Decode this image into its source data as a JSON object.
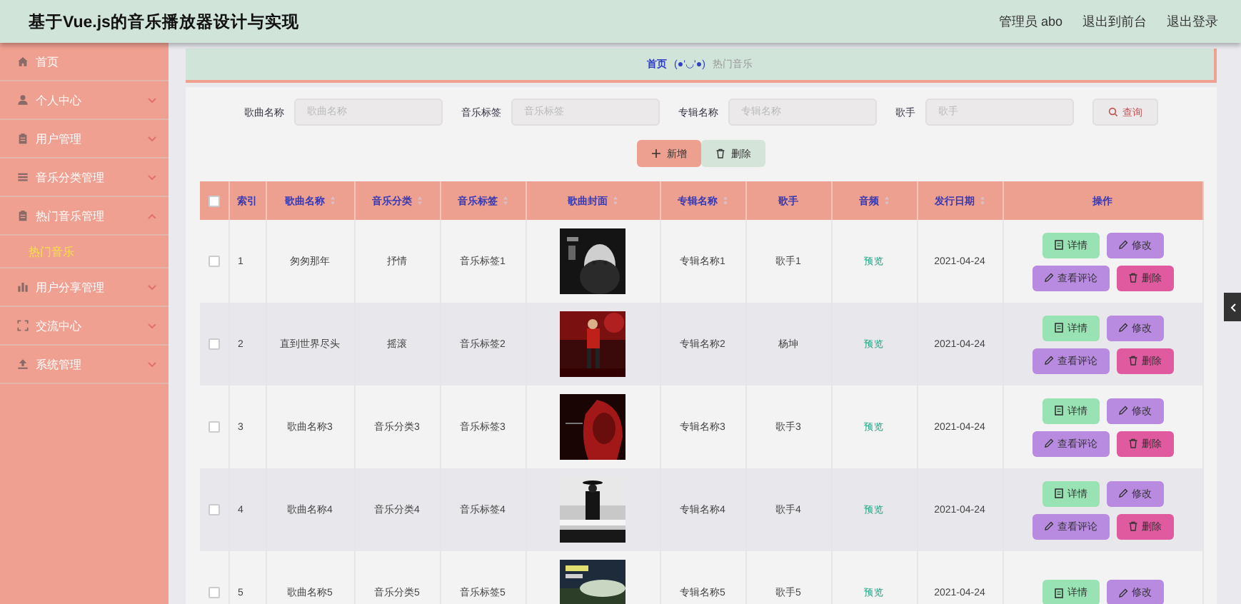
{
  "header": {
    "title": "基于Vue.js的音乐播放器设计与实现",
    "links": [
      "管理员 abo",
      "退出到前台",
      "退出登录"
    ]
  },
  "sidebar": {
    "items": [
      {
        "label": "首页",
        "kind": "link"
      },
      {
        "label": "个人中心",
        "kind": "menu",
        "expanded": false
      },
      {
        "label": "用户管理",
        "kind": "menu",
        "expanded": false
      },
      {
        "label": "音乐分类管理",
        "kind": "menu",
        "expanded": false
      },
      {
        "label": "热门音乐管理",
        "kind": "menu",
        "expanded": true,
        "children": [
          {
            "label": "热门音乐",
            "selected": true
          }
        ]
      },
      {
        "label": "用户分享管理",
        "kind": "menu",
        "expanded": false
      },
      {
        "label": "交流中心",
        "kind": "menu",
        "expanded": false
      },
      {
        "label": "系统管理",
        "kind": "menu",
        "expanded": false
      }
    ]
  },
  "breadcrumb": {
    "home": "首页",
    "separator": "(●'◡'●)",
    "current": "热门音乐"
  },
  "search": {
    "fields": [
      {
        "label": "歌曲名称",
        "placeholder": "歌曲名称"
      },
      {
        "label": "音乐标签",
        "placeholder": "音乐标签"
      },
      {
        "label": "专辑名称",
        "placeholder": "专辑名称"
      },
      {
        "label": "歌手",
        "placeholder": "歌手"
      }
    ],
    "button": "查询"
  },
  "toolbar": [
    {
      "kind": "add",
      "label": "新增"
    },
    {
      "kind": "delete",
      "label": "删除"
    }
  ],
  "table": {
    "select_all": {
      "checked": false
    },
    "columns": [
      {
        "label": "索引",
        "sortable": false
      },
      {
        "label": "歌曲名称",
        "sortable": true
      },
      {
        "label": "音乐分类",
        "sortable": true
      },
      {
        "label": "音乐标签",
        "sortable": true
      },
      {
        "label": "歌曲封面",
        "sortable": true
      },
      {
        "label": "专辑名称",
        "sortable": true
      },
      {
        "label": "歌手",
        "sortable": false
      },
      {
        "label": "音频",
        "sortable": true
      },
      {
        "label": "发行日期",
        "sortable": true
      },
      {
        "label": "操作",
        "sortable": false
      }
    ],
    "rows": [
      {
        "checked": false,
        "index": "1",
        "name": "匆匆那年",
        "category": "抒情",
        "tag": "音乐标签1",
        "cover": {
          "kind": "picture"
        },
        "album": "专辑名称1",
        "singer": "歌手1",
        "audio": "预览",
        "date": "2021-04-24",
        "actions": [
          {
            "kind": "detail",
            "label": "详情"
          },
          {
            "kind": "edit",
            "label": "修改"
          },
          {
            "kind": "comments",
            "label": "查看评论"
          },
          {
            "kind": "delete",
            "label": "删除"
          }
        ]
      },
      {
        "checked": false,
        "index": "2",
        "name": "直到世界尽头",
        "category": "摇滚",
        "tag": "音乐标签2",
        "cover": {
          "kind": "picture"
        },
        "album": "专辑名称2",
        "singer": "杨坤",
        "audio": "预览",
        "date": "2021-04-24",
        "actions": [
          {
            "kind": "detail",
            "label": "详情"
          },
          {
            "kind": "edit",
            "label": "修改"
          },
          {
            "kind": "comments",
            "label": "查看评论"
          },
          {
            "kind": "delete",
            "label": "删除"
          }
        ]
      },
      {
        "checked": false,
        "index": "3",
        "name": "歌曲名称3",
        "category": "音乐分类3",
        "tag": "音乐标签3",
        "cover": {
          "kind": "picture"
        },
        "album": "专辑名称3",
        "singer": "歌手3",
        "audio": "预览",
        "date": "2021-04-24",
        "actions": [
          {
            "kind": "detail",
            "label": "详情"
          },
          {
            "kind": "edit",
            "label": "修改"
          },
          {
            "kind": "comments",
            "label": "查看评论"
          },
          {
            "kind": "delete",
            "label": "删除"
          }
        ]
      },
      {
        "checked": false,
        "index": "4",
        "name": "歌曲名称4",
        "category": "音乐分类4",
        "tag": "音乐标签4",
        "cover": {
          "kind": "picture"
        },
        "album": "专辑名称4",
        "singer": "歌手4",
        "audio": "预览",
        "date": "2021-04-24",
        "actions": [
          {
            "kind": "detail",
            "label": "详情"
          },
          {
            "kind": "edit",
            "label": "修改"
          },
          {
            "kind": "comments",
            "label": "查看评论"
          },
          {
            "kind": "delete",
            "label": "删除"
          }
        ]
      },
      {
        "checked": false,
        "index": "5",
        "name": "歌曲名称5",
        "category": "音乐分类5",
        "tag": "音乐标签5",
        "cover": {
          "kind": "picture"
        },
        "album": "专辑名称5",
        "singer": "歌手5",
        "audio": "预览",
        "date": "2021-04-24",
        "actions": [
          {
            "kind": "detail",
            "label": "详情"
          },
          {
            "kind": "edit",
            "label": "修改"
          }
        ]
      }
    ]
  }
}
